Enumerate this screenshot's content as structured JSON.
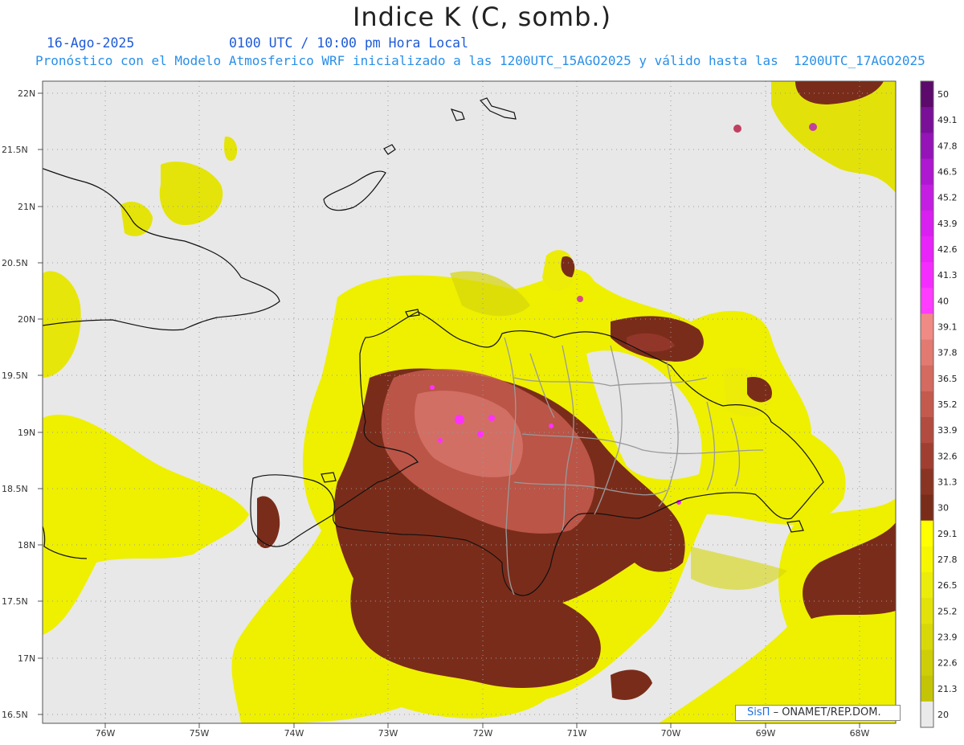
{
  "title": "Indice K (C, somb.)",
  "date_label": "16-Ago-2025",
  "time_label": "0100 UTC / 10:00 pm Hora Local",
  "model_label": "Pronóstico con el Modelo Atmosferico WRF inicializado a las 1200UTC_15AGO2025 y válido hasta las  1200UTC_17AGO2025",
  "map": {
    "lat_labels": [
      "22N",
      "21.5N",
      "21N",
      "20.5N",
      "20N",
      "19.5N",
      "19N",
      "18.5N",
      "18N",
      "17.5N",
      "17N",
      "16.5N"
    ],
    "lon_labels": [
      "76W",
      "75W",
      "74W",
      "73W",
      "72W",
      "71W",
      "70W",
      "69W",
      "68W"
    ],
    "background_color": "#e8e8e8",
    "grid": "dotted"
  },
  "colorbar": {
    "levels": [
      "50",
      "49.1",
      "47.8",
      "46.5",
      "45.2",
      "43.9",
      "42.6",
      "41.3",
      "40",
      "39.1",
      "37.8",
      "36.5",
      "35.2",
      "33.9",
      "32.6",
      "31.3",
      "30",
      "29.1",
      "27.8",
      "26.5",
      "25.2",
      "23.9",
      "22.6",
      "21.3",
      "20"
    ],
    "colors": [
      "#5c0a6b",
      "#7a1098",
      "#9414b8",
      "#ad18d0",
      "#c41ee2",
      "#d820f0",
      "#e824f8",
      "#f52cff",
      "#ff3cff",
      "#f08a84",
      "#e27a72",
      "#d46a60",
      "#c45a4e",
      "#b34c40",
      "#a03e32",
      "#8a3424",
      "#7a2c1a",
      "#ffff00",
      "#f6f600",
      "#ecec0a",
      "#e2e20a",
      "#d8d808",
      "#cece08",
      "#c4c406",
      "#eaeaea"
    ]
  },
  "credit": {
    "brand": "SisΠ",
    "text": "– ONAMET/REP.DOM."
  }
}
